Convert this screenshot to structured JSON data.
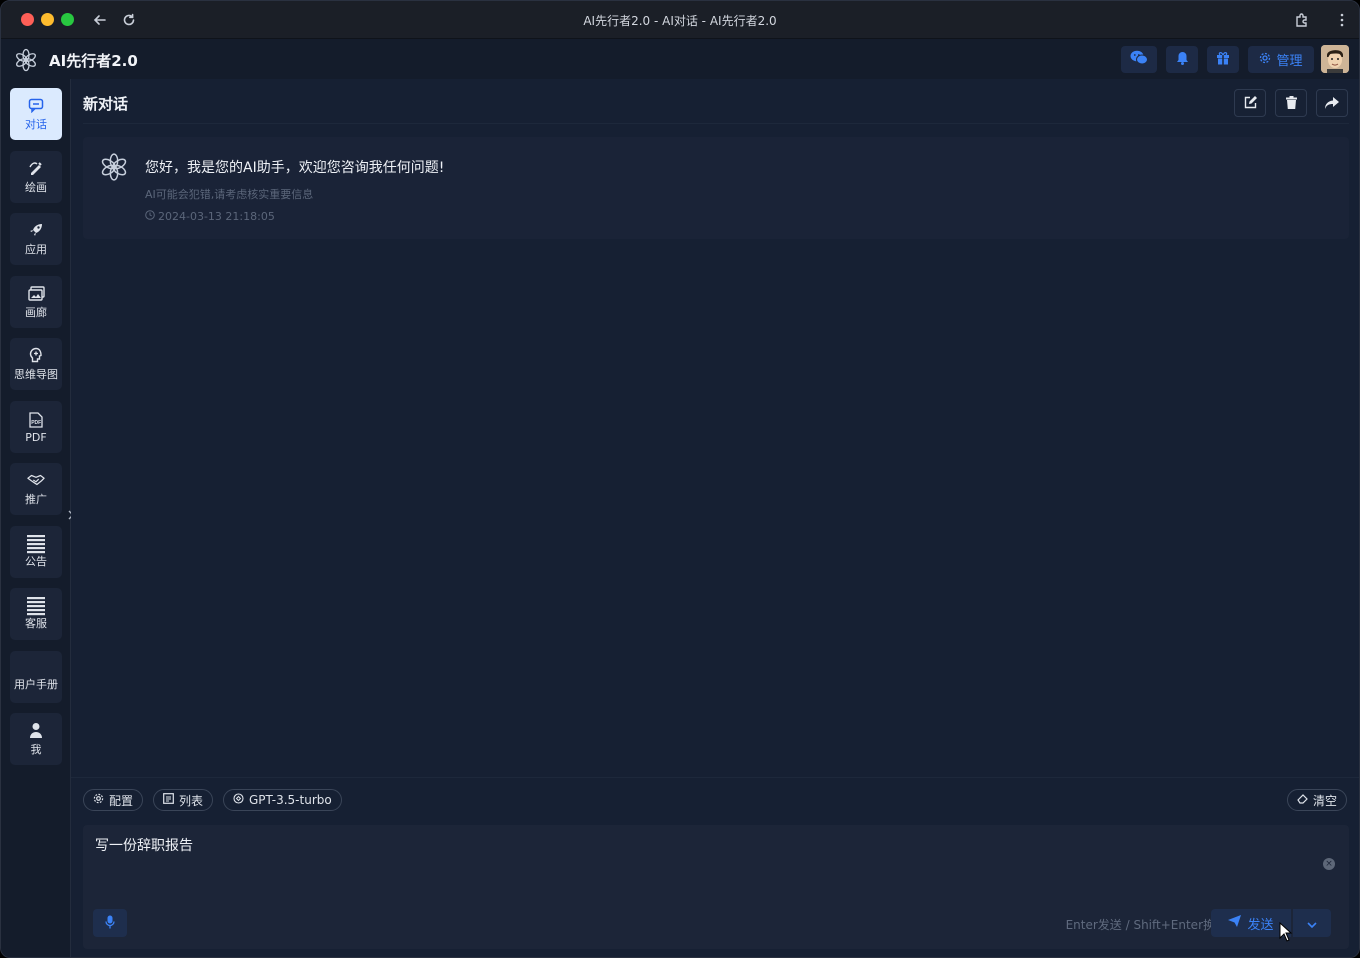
{
  "window": {
    "title": "AI先行者2.0 - AI对话 - AI先行者2.0"
  },
  "header": {
    "brand_name": "AI先行者2.0",
    "buttons": [
      {
        "icon": "wechat-icon"
      },
      {
        "icon": "bell-icon"
      },
      {
        "icon": "gift-icon"
      }
    ],
    "manage_label": "管理"
  },
  "sidebar": {
    "items": [
      {
        "label": "对话",
        "icon": "chat-icon",
        "active": true
      },
      {
        "label": "绘画",
        "icon": "paint-icon"
      },
      {
        "label": "应用",
        "icon": "rocket-icon"
      },
      {
        "label": "画廊",
        "icon": "gallery-icon"
      },
      {
        "label": "思维导图",
        "icon": "mindmap-icon"
      },
      {
        "label": "PDF",
        "icon": "pdf-icon"
      },
      {
        "label": "推广",
        "icon": "handshake-icon"
      },
      {
        "label": "公告",
        "icon": "notice-icon"
      },
      {
        "label": "客服",
        "icon": "service-icon"
      },
      {
        "label": "用户手册",
        "icon": "manual-icon"
      },
      {
        "label": "我",
        "icon": "user-icon"
      }
    ]
  },
  "chat": {
    "title": "新对话",
    "message": {
      "text": "您好，我是您的AI助手，欢迎您咨询我任何问题!",
      "note": "AI可能会犯错,请考虑核实重要信息",
      "time": "2024-03-13 21:18:05"
    }
  },
  "composer": {
    "config_label": "配置",
    "list_label": "列表",
    "model_label": "GPT-3.5-turbo",
    "clear_label": "清空",
    "input_value": "写一份辞职报告",
    "hint": "Enter发送 / Shift+Enter换行",
    "send_label": "发送"
  }
}
